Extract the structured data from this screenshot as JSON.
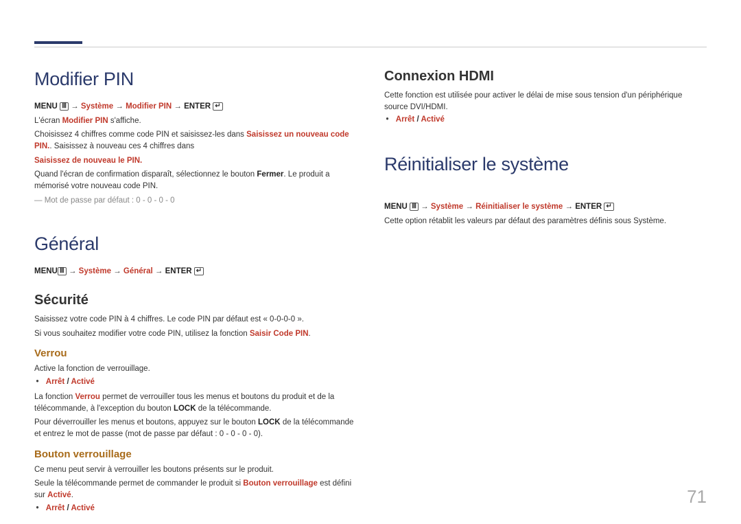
{
  "page_number": "71",
  "left": {
    "h1_modifier": "Modifier PIN",
    "nav1_menu": "MENU",
    "nav1_path": "Système",
    "nav1_path2": "Modifier PIN",
    "nav1_enter": "ENTER",
    "p1a": "L'écran ",
    "p1b": "Modifier PIN",
    "p1c": " s'affiche.",
    "p2a": "Choisissez 4 chiffres comme code PIN et saisissez-les dans ",
    "p2b": "Saisissez un nouveau code PIN.",
    "p2c": ". Saisissez à nouveau ces 4 chiffres dans",
    "p3": "Saisissez de nouveau le PIN.",
    "p4a": "Quand l'écran de confirmation disparaît, sélectionnez le bouton ",
    "p4b": "Fermer",
    "p4c": ". Le produit a mémorisé votre nouveau code PIN.",
    "note_pw": "Mot de passe par défaut : 0 - 0 - 0 - 0",
    "h1_general": "Général",
    "nav2_menu": "MENU",
    "nav2_path": "Système",
    "nav2_path2": "Général",
    "nav2_enter": "ENTER",
    "h2_sec": "Sécurité",
    "sec_p1": "Saisissez votre code PIN à 4 chiffres. Le code PIN par défaut est « 0-0-0-0 ».",
    "sec_p2a": "Si vous souhaitez modifier votre code PIN, utilisez la fonction ",
    "sec_p2b": "Saisir Code PIN",
    "sec_p2c": ".",
    "h3_verrou": "Verrou",
    "verrou_p1": "Active la fonction de verrouillage.",
    "opt_off": "Arrêt",
    "opt_sep": " / ",
    "opt_on": "Activé",
    "verrou_p2a": "La fonction ",
    "verrou_p2b": "Verrou",
    "verrou_p2c": " permet de verrouiller tous les menus et boutons du produit et de la télécommande, à l'exception du bouton ",
    "verrou_p2d": "LOCK",
    "verrou_p2e": " de la télécommande.",
    "verrou_p3a": "Pour déverrouiller les menus et boutons, appuyez sur le bouton ",
    "verrou_p3b": "LOCK",
    "verrou_p3c": " de la télécommande et entrez le mot de passe (mot de passe par défaut : 0 - 0 - 0 - 0).",
    "h3_bouton": "Bouton verrouillage",
    "bouton_p1": "Ce menu peut servir à verrouiller les boutons présents sur le produit.",
    "bouton_p2a": "Seule la télécommande permet de commander le produit si ",
    "bouton_p2b": "Bouton verrouillage",
    "bouton_p2c": " est défini sur ",
    "bouton_p2d": "Activé",
    "bouton_p2e": "."
  },
  "right": {
    "h2_hdmi": "Connexion HDMI",
    "hdmi_p1": "Cette fonction est utilisée pour activer le délai de mise sous tension d'un périphérique source DVI/HDMI.",
    "h1_reset": "Réinitialiser le système",
    "nav_menu": "MENU",
    "nav_path": "Système",
    "nav_path2": "Réinitialiser le système",
    "nav_enter": "ENTER",
    "reset_p1": "Cette option rétablit les valeurs par défaut des paramètres définis sous Système."
  }
}
